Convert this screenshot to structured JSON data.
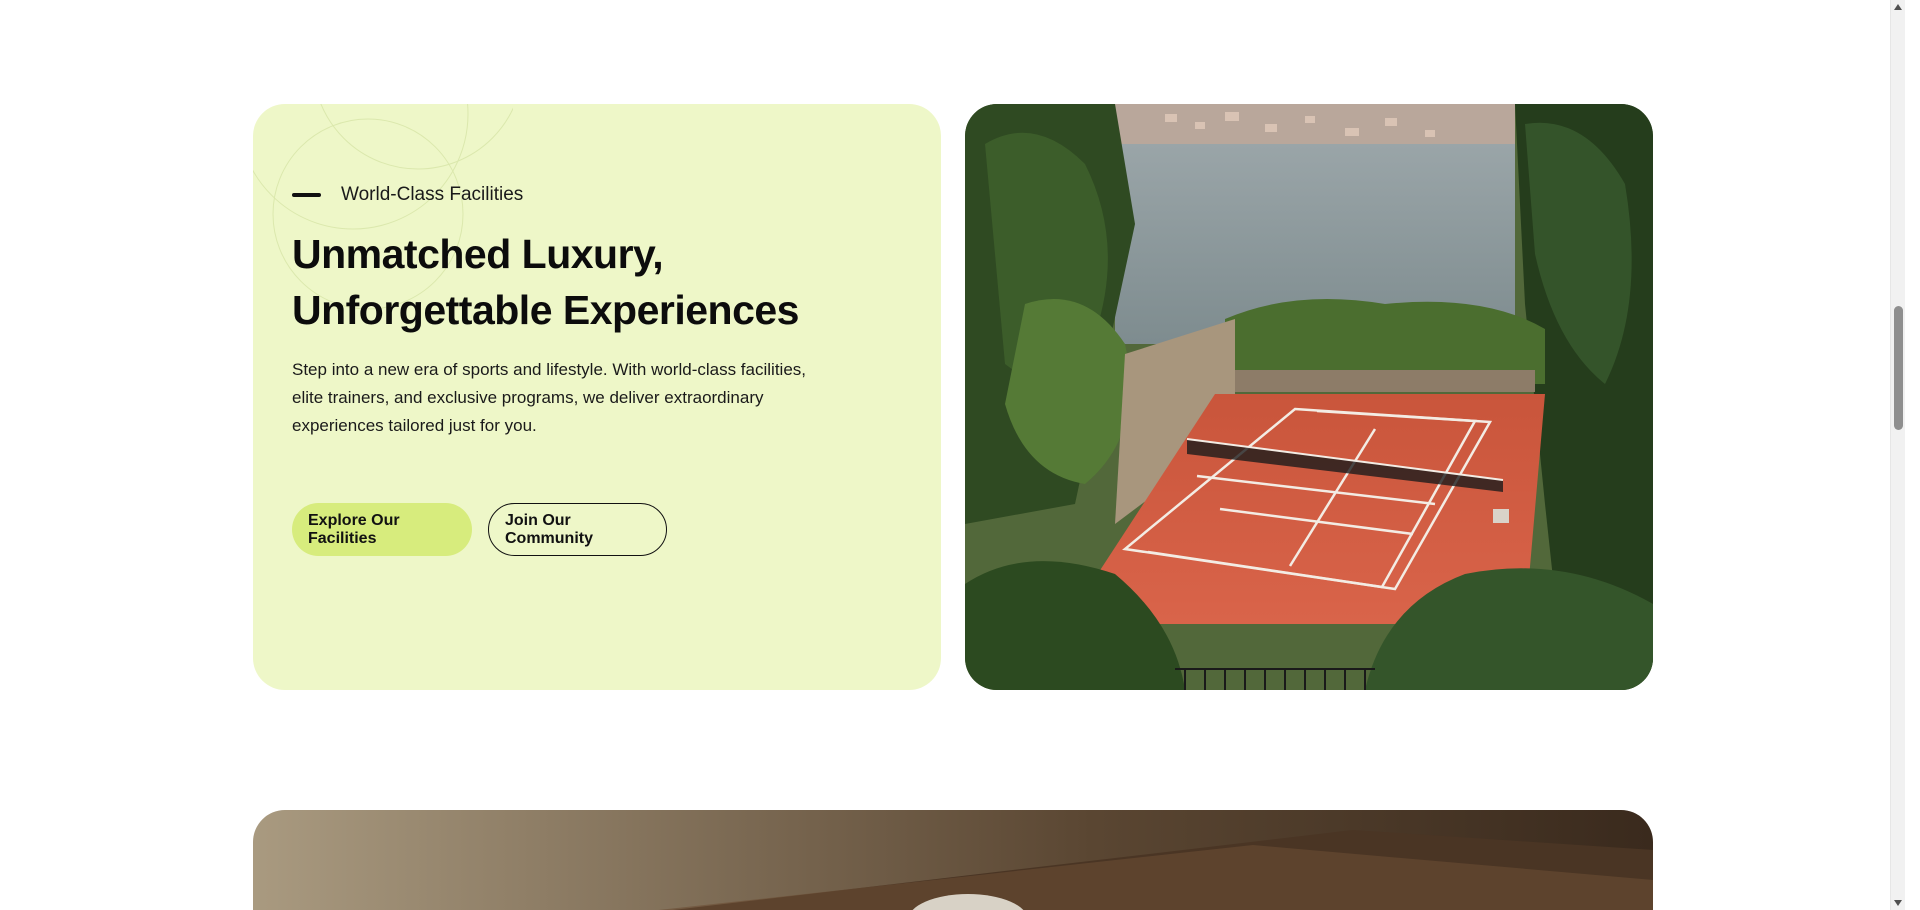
{
  "hero": {
    "eyebrow": "World-Class Facilities",
    "headline": "Unmatched Luxury, Unforgettable Experiences",
    "body": "Step into a new era of sports and lifestyle. With world-class facilities, elite trainers, and exclusive programs, we deliver extraordinary experiences tailored just for you.",
    "primary_button": "Explore Our Facilities",
    "secondary_button": "Join Our Community"
  },
  "images": {
    "facility_image": "clay-tennis-court-lakeside-photo",
    "bottom_image": "tennis-player-cap-photo"
  },
  "colors": {
    "card_background": "#eef7c8",
    "accent_button": "#d7ec7d",
    "court_clay": "#d7563a",
    "text": "#111111"
  },
  "icons": {
    "scroll_up": "chevron-up-icon",
    "scroll_down": "chevron-down-icon"
  }
}
